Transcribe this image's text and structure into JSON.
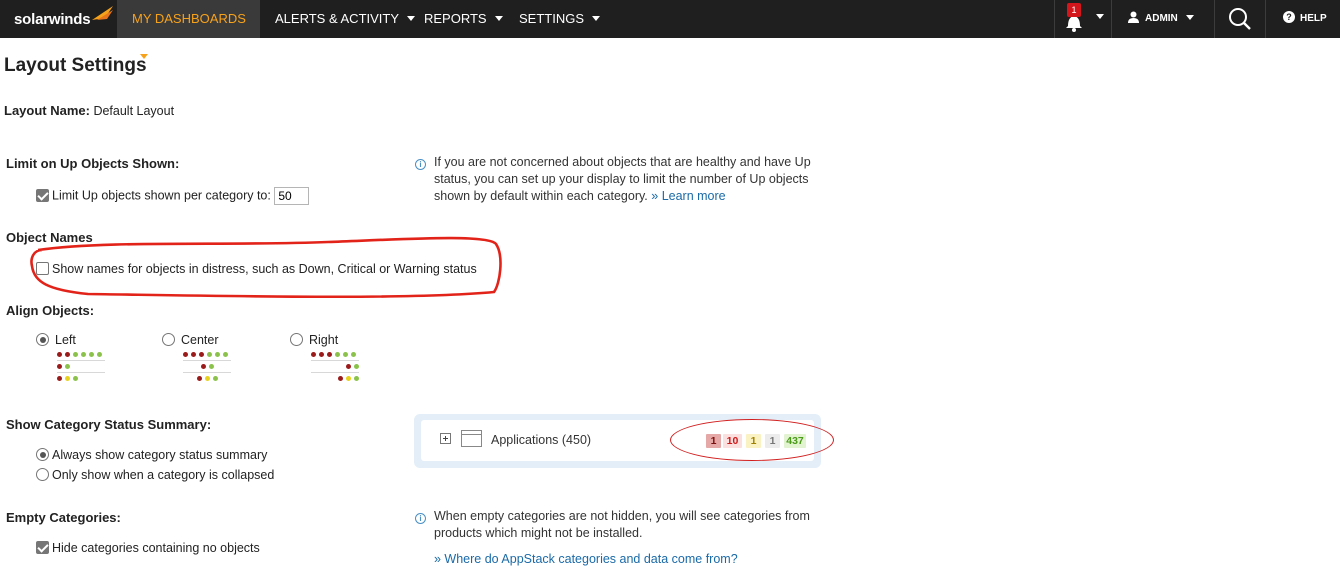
{
  "topbar": {
    "logo_text": "solarwinds",
    "nav": [
      {
        "label": "MY DASHBOARDS"
      },
      {
        "label": "ALERTS & ACTIVITY"
      },
      {
        "label": "REPORTS"
      },
      {
        "label": "SETTINGS"
      }
    ],
    "notification_count": "1",
    "user_label": "ADMIN",
    "help_label": "HELP",
    "colors": {
      "bar": "#1f1f1f",
      "active_text": "#f7a21b",
      "badge": "#d2161c"
    }
  },
  "page": {
    "title": "Layout Settings",
    "layout_name_label": "Layout Name:",
    "layout_name_value": "Default Layout"
  },
  "limit": {
    "label": "Limit on Up Objects Shown:",
    "checkbox_label": "Limit Up objects shown per category to:",
    "checked": true,
    "value": "50",
    "info": "If you are not concerned about objects that are healthy and have Up status, you can set up your display to limit the number of Up objects shown by default within each category.",
    "learn_more": "» Learn more"
  },
  "object_names": {
    "label": "Object Names",
    "checkbox_label": "Show names for objects in distress, such as Down, Critical or Warning status",
    "checked": false
  },
  "align": {
    "label": "Align Objects:",
    "options": [
      {
        "label": "Left",
        "selected": true
      },
      {
        "label": "Center",
        "selected": false
      },
      {
        "label": "Right",
        "selected": false
      }
    ]
  },
  "summary": {
    "label": "Show Category Status Summary:",
    "options": [
      {
        "label": "Always show category status summary",
        "selected": true
      },
      {
        "label": "Only show when a category is collapsed",
        "selected": false
      }
    ],
    "preview": {
      "category": "Applications (450)",
      "badges": [
        "1",
        "10",
        "1",
        "1",
        "437"
      ]
    }
  },
  "empty": {
    "label": "Empty Categories:",
    "checkbox_label": "Hide categories containing no objects",
    "checked": true,
    "info": "When empty categories are not hidden, you will see categories from products which might not be installed.",
    "link": "» Where do AppStack categories and data come from?"
  }
}
